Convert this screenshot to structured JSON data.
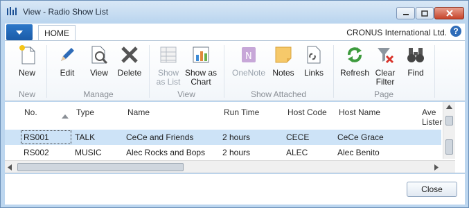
{
  "window": {
    "title": "View - Radio Show List"
  },
  "tabs": {
    "home": "HOME",
    "company": "CRONUS International Ltd.",
    "help": "?"
  },
  "ribbon": {
    "new": "New",
    "edit": "Edit",
    "view": "View",
    "delete": "Delete",
    "show_as_list": "Show as List",
    "show_as_chart": "Show as Chart",
    "onenote": "OneNote",
    "notes": "Notes",
    "links": "Links",
    "refresh": "Refresh",
    "clear_filter": "Clear Filter",
    "find": "Find",
    "groups": {
      "new": "New",
      "manage": "Manage",
      "view": "View",
      "show_attached": "Show Attached",
      "page": "Page"
    }
  },
  "table": {
    "columns": [
      "No.",
      "Type",
      "Name",
      "Run Time",
      "Host Code",
      "Host Name",
      "Ave Lister"
    ],
    "rows": [
      {
        "no": "RS001",
        "type": "TALK",
        "name": "CeCe and Friends",
        "run_time": "2 hours",
        "host_code": "CECE",
        "host_name": "CeCe Grace"
      },
      {
        "no": "RS002",
        "type": "MUSIC",
        "name": "Alec Rocks and Bops",
        "run_time": "2 hours",
        "host_code": "ALEC",
        "host_name": "Alec Benito"
      }
    ]
  },
  "footer": {
    "close": "Close"
  },
  "colors": {
    "accent": "#1b5ca8",
    "selected_row": "#cde3f7",
    "close_button": "#c7432a"
  }
}
